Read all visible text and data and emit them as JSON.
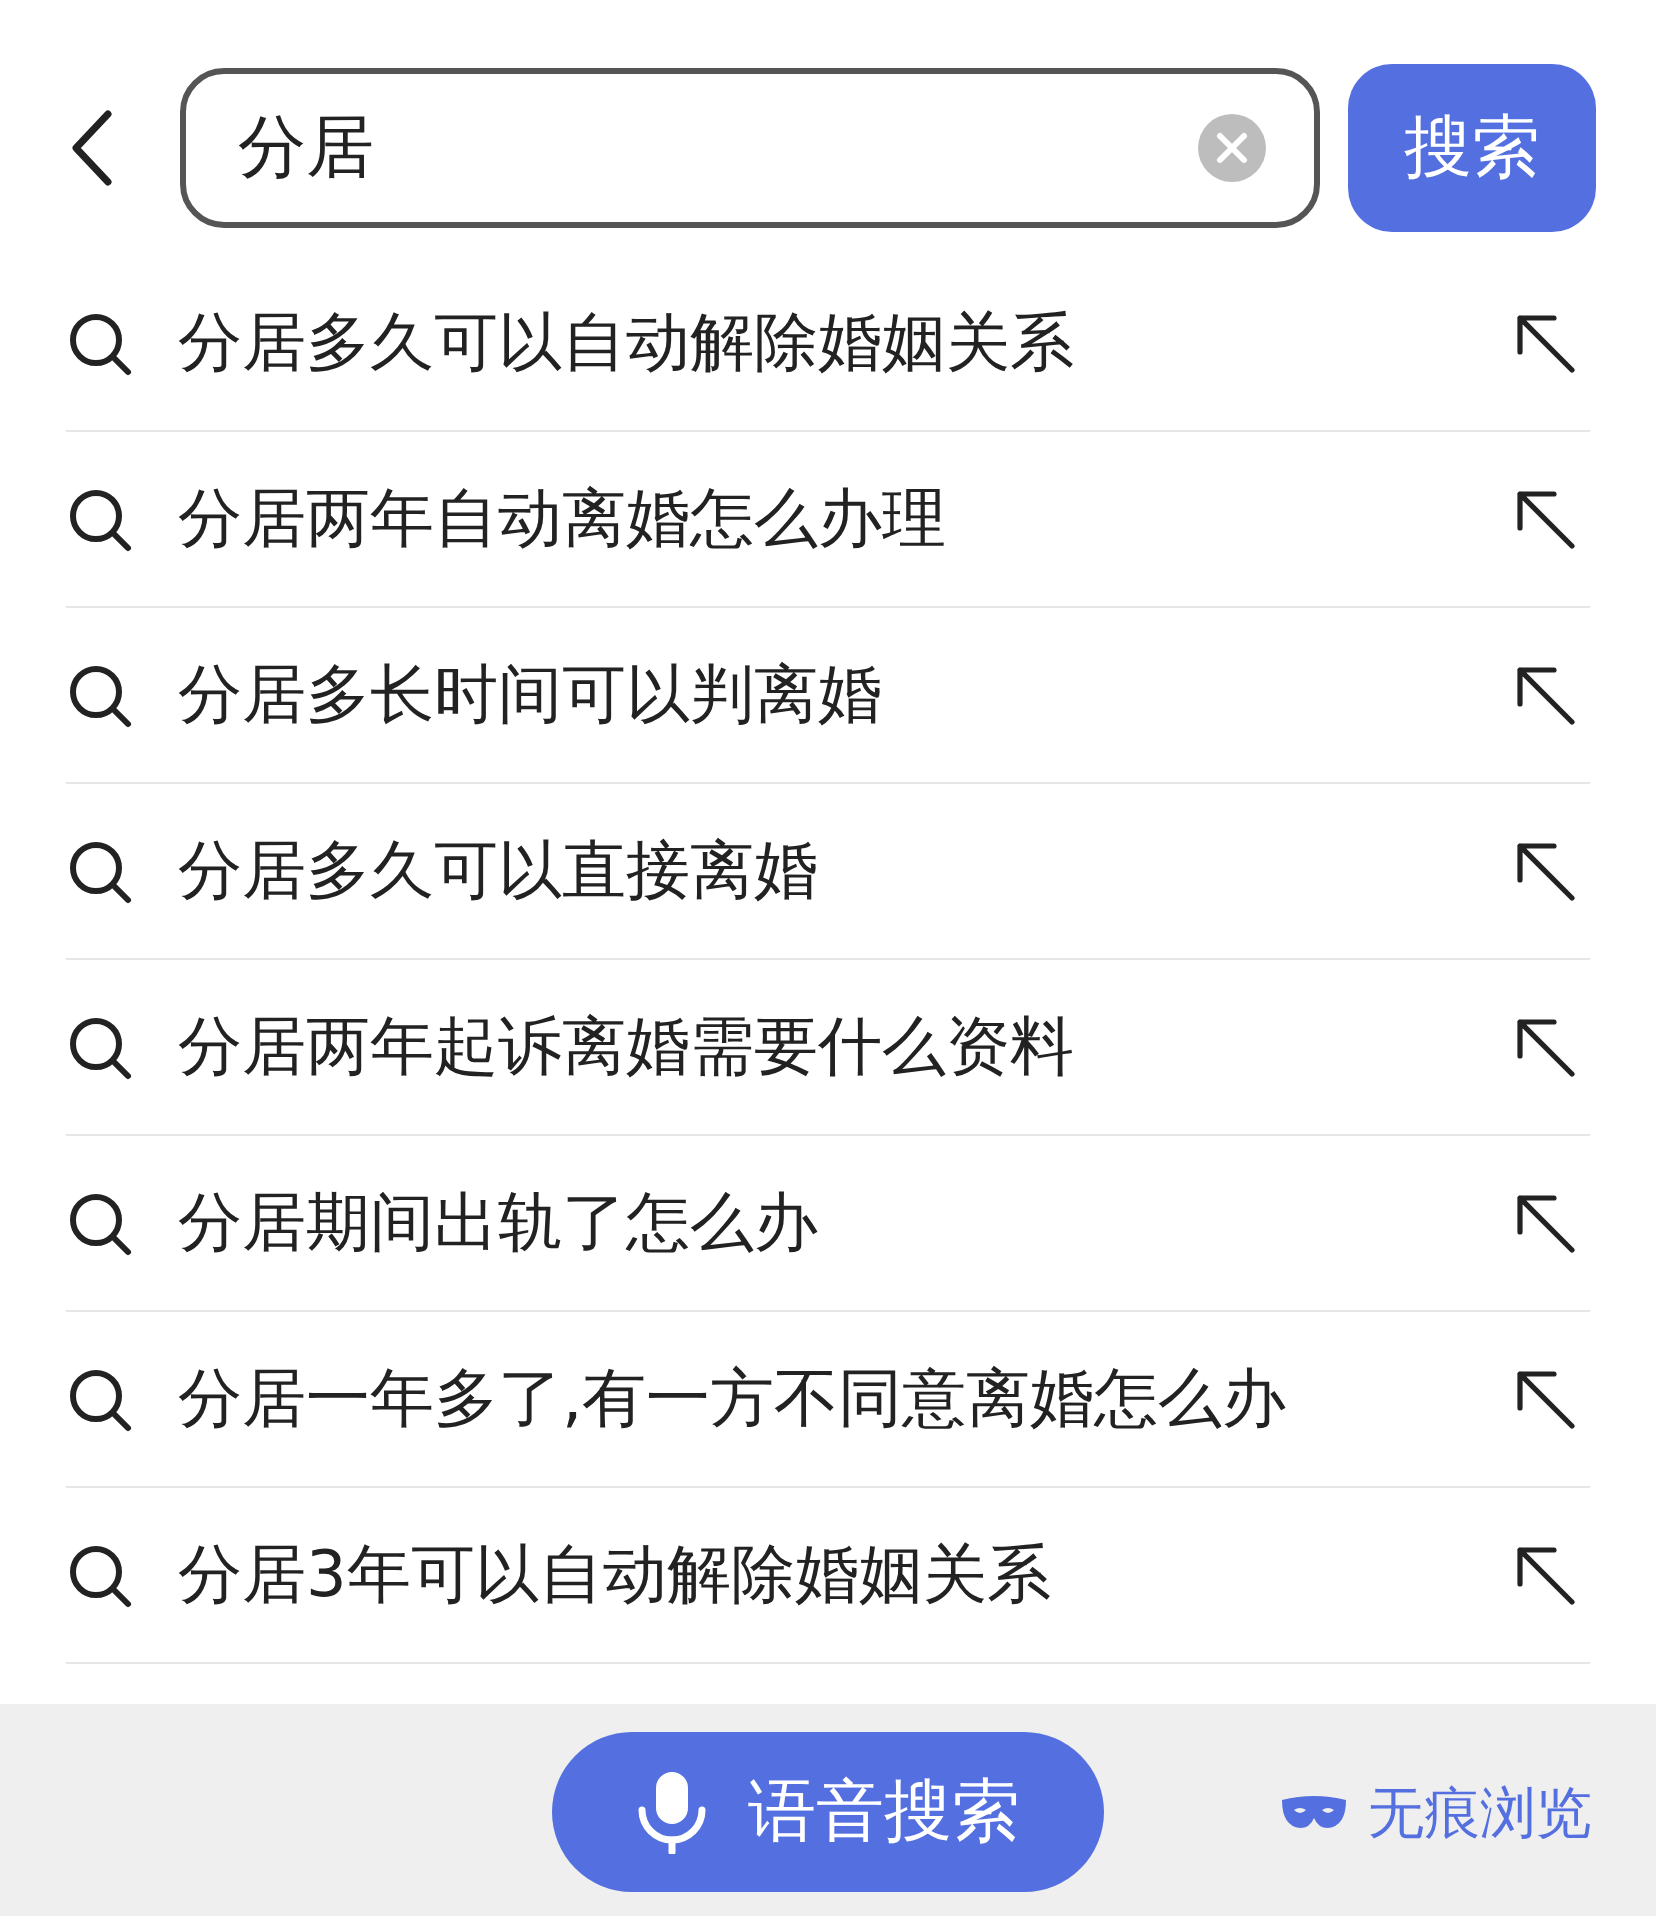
{
  "search": {
    "value": "分居",
    "button": "搜索"
  },
  "suggestions": [
    {
      "text": "分居多久可以自动解除婚姻关系"
    },
    {
      "text": "分居两年自动离婚怎么办理"
    },
    {
      "text": "分居多长时间可以判离婚"
    },
    {
      "text": "分居多久可以直接离婚"
    },
    {
      "text": "分居两年起诉离婚需要什么资料"
    },
    {
      "text": "分居期间出轨了怎么办"
    },
    {
      "text": "分居一年多了,有一方不同意离婚怎么办"
    },
    {
      "text": "分居3年可以自动解除婚姻关系"
    }
  ],
  "bottom_bar": {
    "voice_button": "语音搜索",
    "incognito": "无痕浏览"
  }
}
